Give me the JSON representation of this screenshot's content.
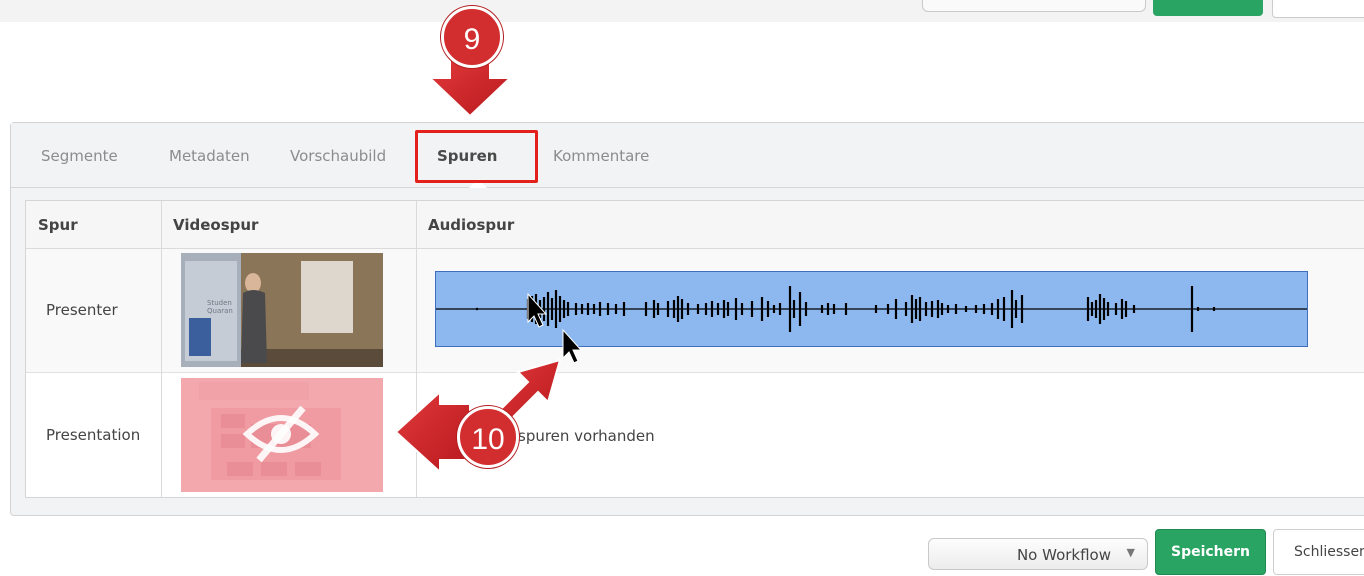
{
  "tabs": [
    {
      "label": "Segmente"
    },
    {
      "label": "Metadaten"
    },
    {
      "label": "Vorschaubild"
    },
    {
      "label": "Spuren"
    },
    {
      "label": "Kommentare"
    }
  ],
  "table": {
    "headers": {
      "track": "Spur",
      "video": "Videospur",
      "audio": "Audiospur"
    },
    "rows": [
      {
        "label": "Presenter"
      },
      {
        "label": "Presentation",
        "audio_text": "spuren vorhanden"
      }
    ]
  },
  "footer": {
    "workflow_selected": "No Workflow",
    "save_label": "Speichern",
    "close_label": "Schliessen"
  },
  "annotations": {
    "step_a": "9",
    "step_b": "10"
  },
  "colors": {
    "accent_green": "#2aa463",
    "annotation_red": "#d22d2f",
    "waveform_bg": "#8db8ef"
  }
}
